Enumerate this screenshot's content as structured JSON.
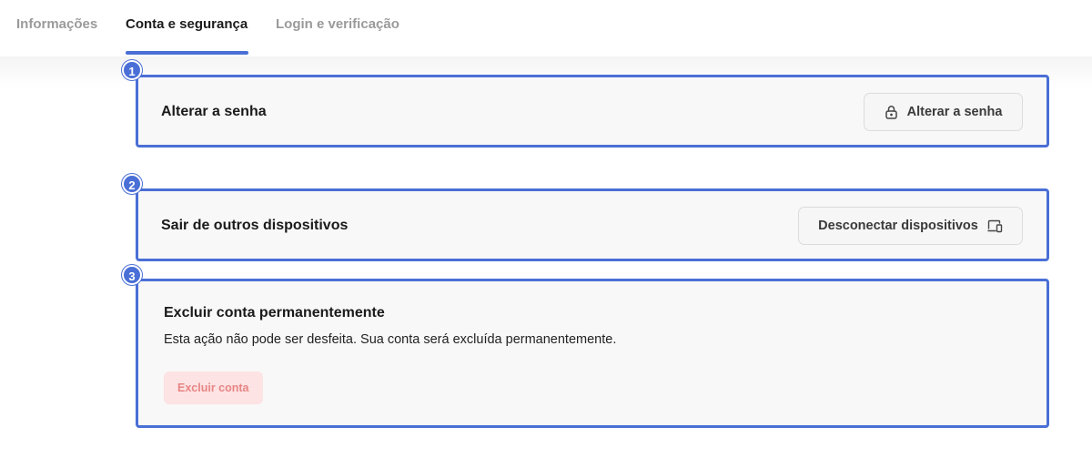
{
  "tabs": [
    {
      "label": "Informações",
      "active": false
    },
    {
      "label": "Conta e segurança",
      "active": true
    },
    {
      "label": "Login e verificação",
      "active": false
    }
  ],
  "accent_color": "#4a6fd6",
  "sections": {
    "password": {
      "badge": "1",
      "title": "Alterar a senha",
      "button_label": "Alterar a senha",
      "button_icon": "lock-icon"
    },
    "devices": {
      "badge": "2",
      "title": "Sair de outros dispositivos",
      "button_label": "Desconectar dispositivos",
      "button_icon": "devices-icon"
    },
    "delete": {
      "badge": "3",
      "title": "Excluir conta permanentemente",
      "description": "Esta ação não pode ser desfeita. Sua conta será excluída permanentemente.",
      "button_label": "Excluir conta",
      "button_color": "#fde3e3",
      "button_text_color": "#e88585"
    }
  }
}
